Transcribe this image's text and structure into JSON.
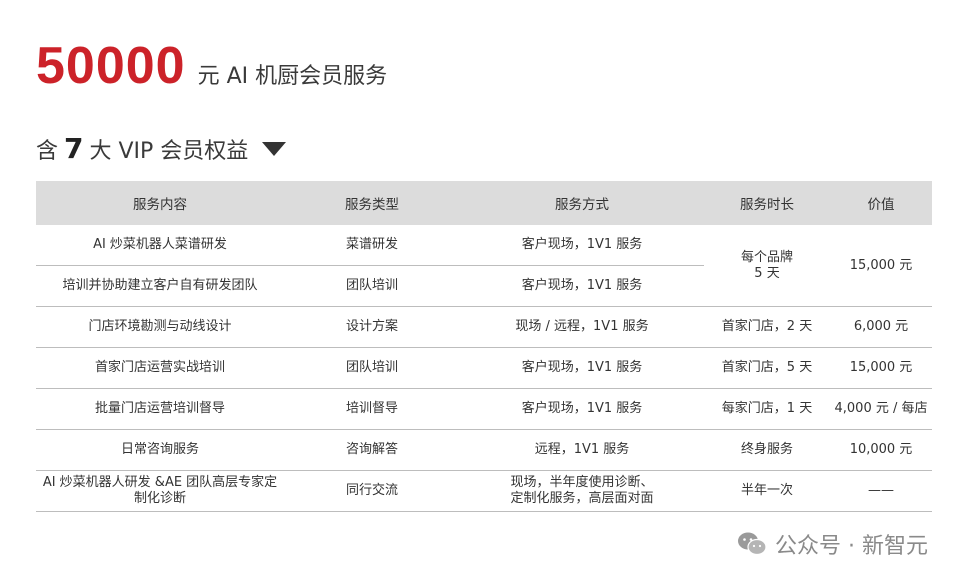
{
  "header": {
    "price": "50000",
    "price_suffix": "元 AI 机厨会员服务",
    "subtitle_prefix": "含",
    "subtitle_number": "7",
    "subtitle_suffix": "大 VIP 会员权益"
  },
  "table": {
    "columns": [
      "服务内容",
      "服务类型",
      "服务方式",
      "服务时长",
      "价值"
    ],
    "rows": [
      {
        "content": "AI 炒菜机器人菜谱研发",
        "type": "菜谱研发",
        "method": "客户现场，1V1 服务"
      },
      {
        "content": "培训并协助建立客户自有研发团队",
        "type": "团队培训",
        "method": "客户现场，1V1 服务"
      },
      {
        "content": "门店环境勘测与动线设计",
        "type": "设计方案",
        "method": "现场 / 远程，1V1 服务",
        "duration": "首家门店，2 天",
        "value": "6,000 元"
      },
      {
        "content": "首家门店运营实战培训",
        "type": "团队培训",
        "method": "客户现场，1V1 服务",
        "duration": "首家门店，5 天",
        "value": "15,000 元"
      },
      {
        "content": "批量门店运营培训督导",
        "type": "培训督导",
        "method": "客户现场，1V1 服务",
        "duration": "每家门店，1 天",
        "value": "4,000 元 / 每店"
      },
      {
        "content": "日常咨询服务",
        "type": "咨询解答",
        "method": "远程，1V1 服务",
        "duration": "终身服务",
        "value": "10,000 元"
      },
      {
        "content_line1": "AI 炒菜机器人研发 &AE 团队高层专家定",
        "content_line2": "制化诊断",
        "type": "同行交流",
        "method_line1": "现场，半年度使用诊断、",
        "method_line2": "定制化服务，高层面对面",
        "duration": "半年一次",
        "value": "——"
      }
    ],
    "merged": {
      "duration_line1": "每个品牌",
      "duration_line2": "5 天",
      "value": "15,000 元"
    }
  },
  "watermark": {
    "icon": "wechat-icon",
    "text": "公众号 · 新智元"
  },
  "colors": {
    "accent": "#cc2229",
    "header_bg": "#dcdcdc"
  }
}
